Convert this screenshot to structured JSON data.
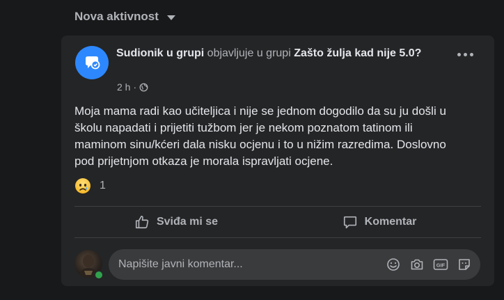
{
  "feed": {
    "header": "Nova aktivnost"
  },
  "post": {
    "author": "Sudionik u grupi",
    "action": "objavljuje u grupi",
    "group": "Zašto žulja kad nije 5.0?",
    "time": "2 h",
    "separator": "·",
    "privacy_icon": "globe-icon",
    "body": "Moja mama radi kao učiteljica i nije se jednom dogodilo da su ju došli u školu napadati i prijetiti tužbom jer je nekom poznatom tatinom ili maminom sinu/kćeri dala nisku ocjenu i to u nižim razredima. Doslovno pod prijetnjom otkaza je morala ispravljati ocjene.",
    "reaction_icon": "sad-face-icon",
    "reaction_count": "1"
  },
  "actions": {
    "like": "Sviđa mi se",
    "comment": "Komentar"
  },
  "composer": {
    "placeholder": "Napišite javni komentar...",
    "icons": [
      "emoji-icon",
      "camera-icon",
      "gif-icon",
      "sticker-icon"
    ]
  },
  "colors": {
    "background": "#18191a",
    "card": "#242526",
    "primary_text": "#e4e6eb",
    "secondary_text": "#b0b3b8",
    "group_icon": "#2d88ff",
    "online": "#31a24c"
  }
}
